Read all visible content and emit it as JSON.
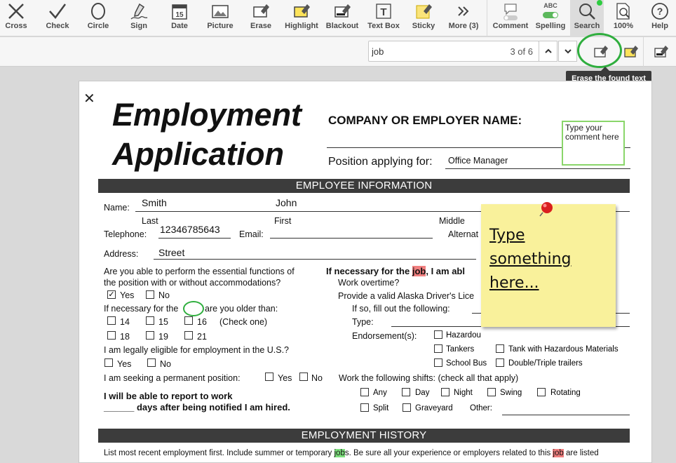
{
  "toolbar": {
    "tools": [
      {
        "label": "Cross",
        "icon": "cross-icon"
      },
      {
        "label": "Check",
        "icon": "check-icon"
      },
      {
        "label": "Circle",
        "icon": "circle-icon"
      },
      {
        "label": "Sign",
        "icon": "sign-icon"
      },
      {
        "label": "Date",
        "icon": "date-icon"
      },
      {
        "label": "Picture",
        "icon": "picture-icon"
      },
      {
        "label": "Erase",
        "icon": "erase-icon"
      },
      {
        "label": "Highlight",
        "icon": "highlight-icon"
      },
      {
        "label": "Blackout",
        "icon": "blackout-icon"
      },
      {
        "label": "Text Box",
        "icon": "textbox-icon"
      },
      {
        "label": "Sticky",
        "icon": "sticky-icon"
      },
      {
        "label": "More (3)",
        "icon": "more-icon"
      },
      {
        "label": "Comment",
        "icon": "comment-icon"
      },
      {
        "label": "Spelling",
        "icon": "spelling-icon",
        "badge": "ABC"
      },
      {
        "label": "Search",
        "icon": "search-icon"
      },
      {
        "label": "100%",
        "icon": "zoom-icon"
      },
      {
        "label": "Help",
        "icon": "help-icon"
      }
    ]
  },
  "search": {
    "value": "job",
    "count": "3 of 6"
  },
  "tooltip": "Erase the found text",
  "form": {
    "title_line1": "Employment",
    "title_line2": "Application",
    "company_label": "COMPANY OR EMPLOYER NAME:",
    "position_label": "Position applying for:",
    "position_value": "Office Manager",
    "comment_text": "Type your comment here",
    "section1": "EMPLOYEE INFORMATION",
    "name_label": "Name:",
    "last_value": "Smith",
    "first_value": "John",
    "last_label": "Last",
    "first_label": "First",
    "middle_label": "Middle",
    "telephone_label": "Telephone:",
    "telephone_value": "12346785643",
    "email_label": "Email:",
    "alternate_label": "Alternat",
    "address_label": "Address:",
    "address_value": "Street",
    "q1_line1": "Are you able to perform the essential functions of",
    "q1_line2": "the position with or without accommodations?",
    "yes": "Yes",
    "no": "No",
    "q2_pre": "If necessary for the",
    "q2_post": "are you older than:",
    "ages": [
      "14",
      "15",
      "16",
      "18",
      "19",
      "21"
    ],
    "check_one": "(Check one)",
    "q3": "I am legally eligible for employment in the U.S.?",
    "q4": "I am seeking a permanent position:",
    "q5_line1": "I will be able to report to work",
    "q5_line2": "______ days after being notified I am hired.",
    "right_q_pre": "If necessary for the",
    "right_q_job": "job",
    "right_q_post": ", I am abl",
    "work_overtime": "Work overtime?",
    "drivers_license": "Provide a valid Alaska Driver's Lice",
    "if_so": "If so, fill out the following:",
    "type_label": "Type:",
    "endorsements_label": "Endorsement(s):",
    "endorsements": [
      "Hazardou",
      "Tankers",
      "Tank with Hazardous Materials",
      "School Bus",
      "Double/Triple trailers"
    ],
    "shifts_label": "Work the following shifts: (check all that apply)",
    "shifts": [
      "Any",
      "Day",
      "Night",
      "Swing",
      "Rotating",
      "Split",
      "Graveyard"
    ],
    "other_label": "Other:",
    "section2": "EMPLOYMENT HISTORY",
    "history_a": "List most recent employment first. Include summer or temporary ",
    "history_b": "job",
    "history_c": "s. Be sure all your experience or employers related to this ",
    "history_d": "job",
    "history_e": " are listed"
  },
  "sticky_text": "Type something here..."
}
